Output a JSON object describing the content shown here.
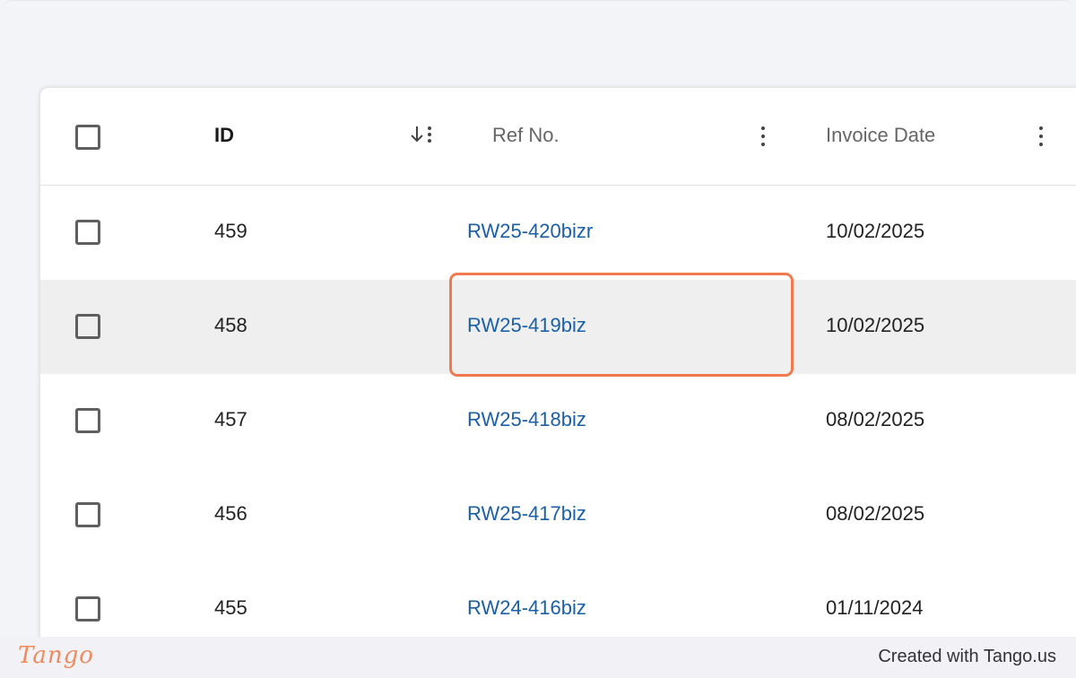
{
  "table": {
    "columns": {
      "id": "ID",
      "ref_no": "Ref No.",
      "invoice_date": "Invoice Date"
    },
    "rows": [
      {
        "id": "459",
        "ref_no": "RW25-420bizr",
        "invoice_date": "10/02/2025"
      },
      {
        "id": "458",
        "ref_no": "RW25-419biz",
        "invoice_date": "10/02/2025"
      },
      {
        "id": "457",
        "ref_no": "RW25-418biz",
        "invoice_date": "08/02/2025"
      },
      {
        "id": "456",
        "ref_no": "RW25-417biz",
        "invoice_date": "08/02/2025"
      },
      {
        "id": "455",
        "ref_no": "RW24-416biz",
        "invoice_date": "01/11/2024"
      }
    ]
  },
  "footer": {
    "brand": "Tango",
    "created_with": "Created with Tango.us"
  },
  "colors": {
    "link": "#1a5fa8",
    "highlight": "#f07a4e",
    "hover_row": "#efefef",
    "brand": "#f08a5d"
  }
}
